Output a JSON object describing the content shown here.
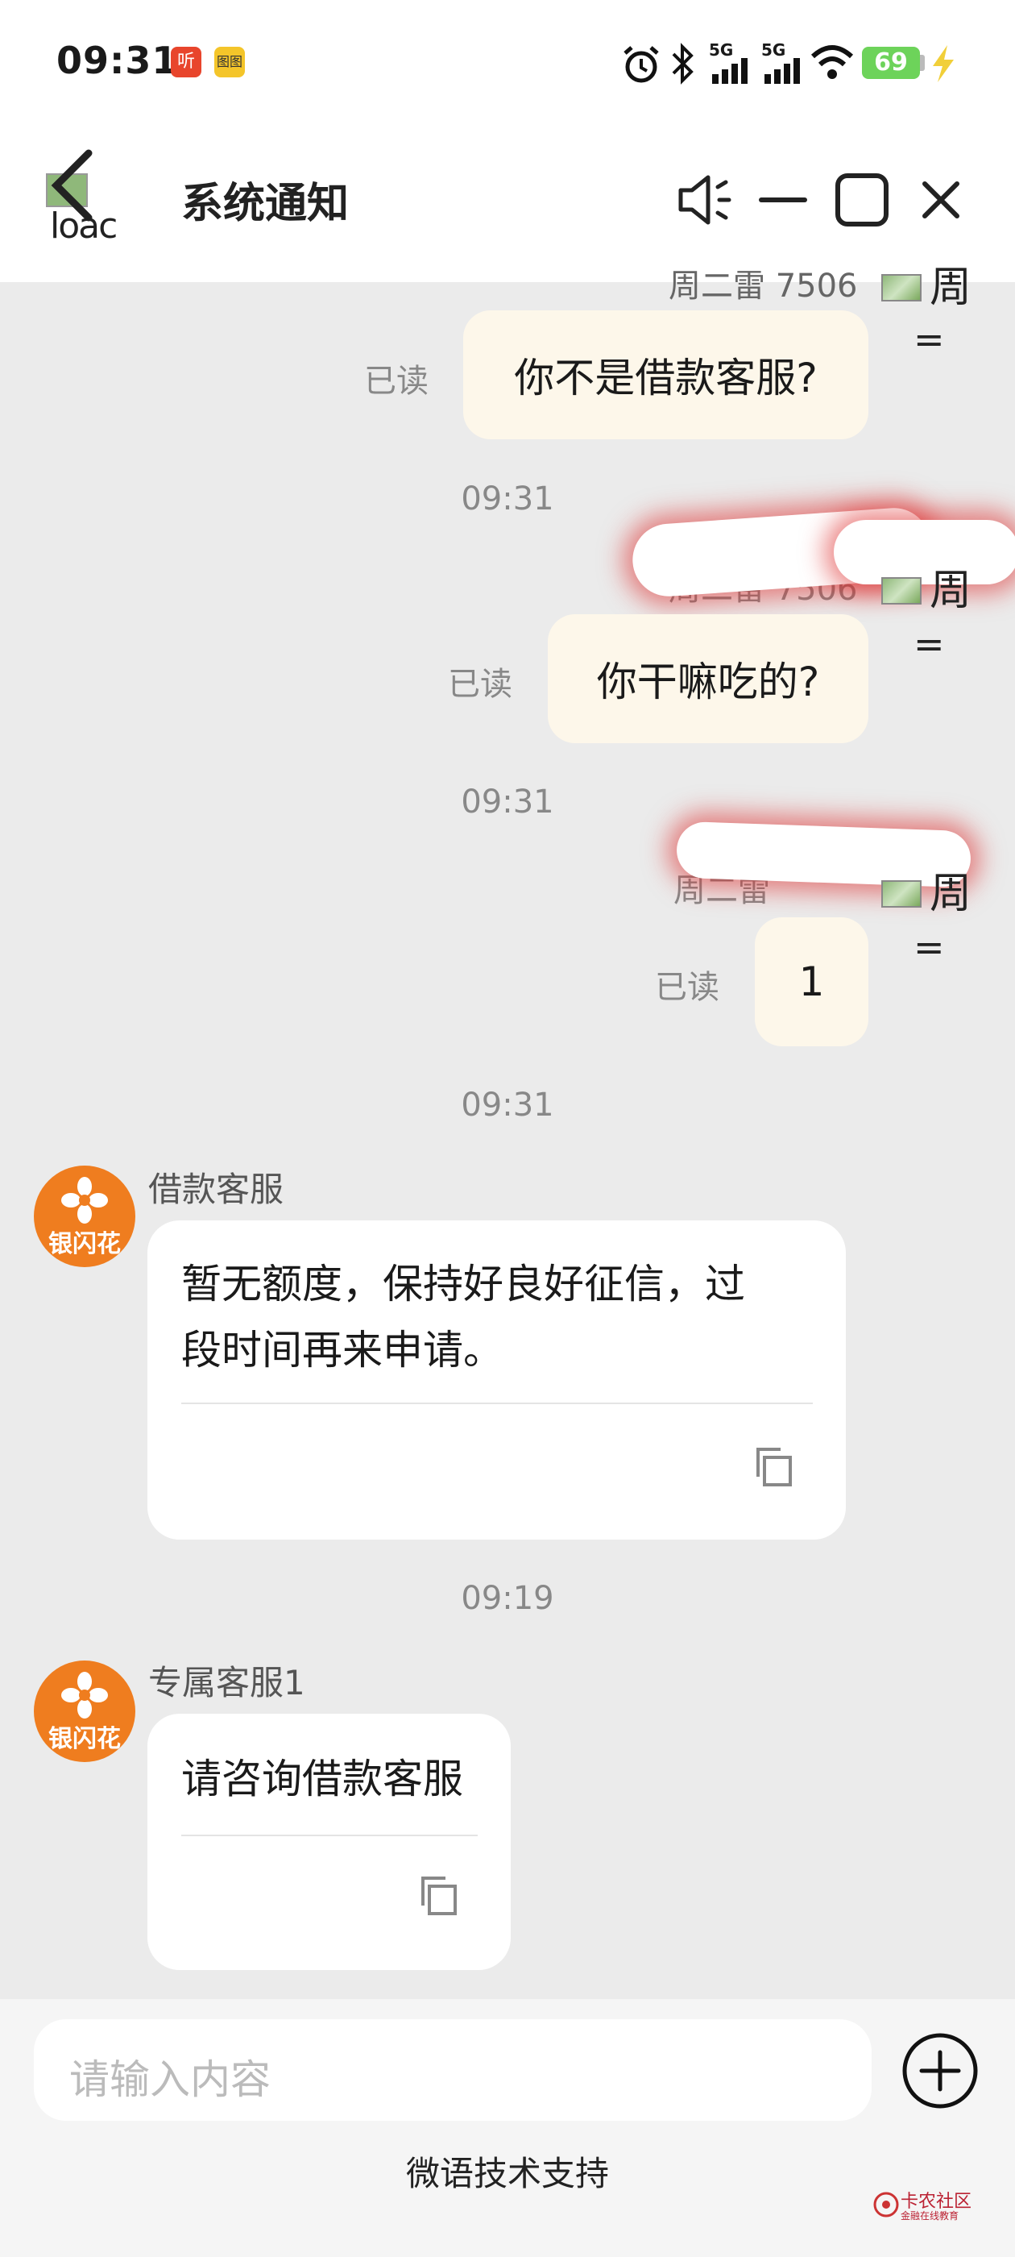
{
  "status_bar": {
    "time": "09:31",
    "app_icon_1": "听",
    "app_icon_2": "图图",
    "network_1": "5G",
    "network_2": "5G",
    "battery": "69",
    "icons": [
      "alarm-icon",
      "bluetooth-icon",
      "signal-icon",
      "signal-icon",
      "wifi-icon",
      "battery-icon",
      "charging-icon"
    ]
  },
  "header": {
    "back_alt_text": "loac",
    "title": "系统通知",
    "buttons": [
      "speaker-icon",
      "minimize-icon",
      "maximize-icon",
      "close-icon"
    ]
  },
  "messages_out": [
    {
      "nick": "周二雷 7506",
      "text": "你不是借款客服?",
      "status": "已读",
      "avatar_text": "周",
      "avatar_sub": "="
    },
    {
      "nick": "周二雷 7506",
      "text": "你干嘛吃的?",
      "status": "已读",
      "avatar_text": "周",
      "avatar_sub": "="
    },
    {
      "nick": "周二雷",
      "text": "1",
      "status": "已读",
      "avatar_text": "周",
      "avatar_sub": "="
    }
  ],
  "timestamps": [
    "09:31",
    "09:31",
    "09:31",
    "09:19"
  ],
  "messages_in": [
    {
      "sender": "借款客服",
      "avatar_label": "银闪花",
      "text_line1": "暂无额度，保持好良好征信，过",
      "text_line2": "段时间再来申请。"
    },
    {
      "sender": "专属客服1",
      "avatar_label": "银闪花",
      "text_line1": "请咨询借款客服"
    }
  ],
  "input": {
    "placeholder": "请输入内容"
  },
  "footer": {
    "support_text": "微语技术支持",
    "watermark": "卡农社区",
    "watermark_sub": "金融在线教育"
  },
  "colors": {
    "chat_bg": "#ebebeb",
    "outgoing_bubble": "#fdf7ea",
    "avatar_orange": "#ef7d1f",
    "battery_green": "#6dd35a"
  }
}
